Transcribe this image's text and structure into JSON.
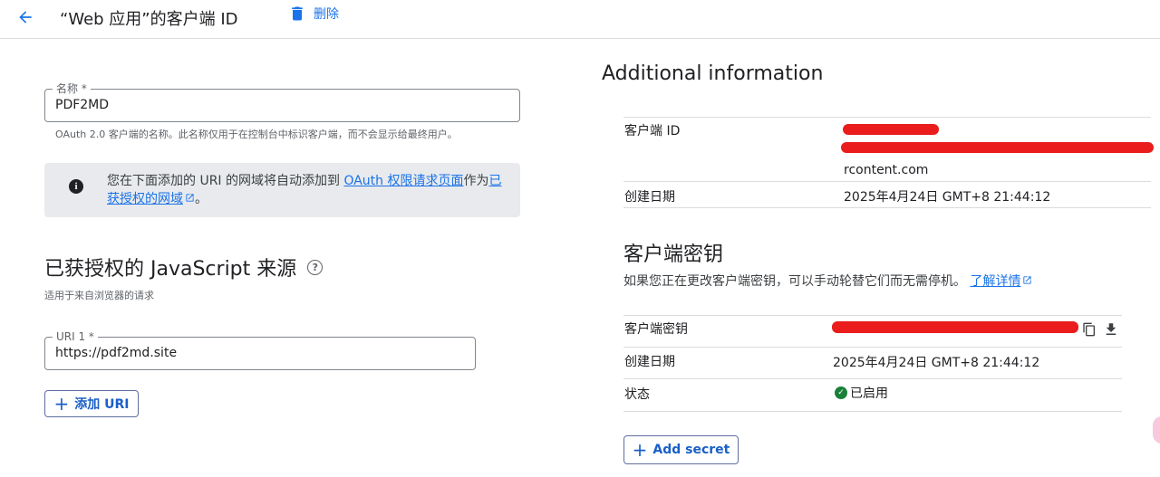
{
  "header": {
    "title": "“Web 应用”的客户端 ID",
    "delete_label": "删除"
  },
  "form": {
    "name_label": "名称 *",
    "name_value": "PDF2MD",
    "name_hint": "OAuth 2.0 客户端的名称。此名称仅用于在控制台中标识客户端，而不会显示给最终用户。",
    "info": {
      "text_before": "您在下面添加的 URI 的网域将自动添加到 ",
      "link1": "OAuth 权限请求页面",
      "text_middle": "作为",
      "link2": "已获授权的网域",
      "text_after": "。"
    },
    "js_origins": {
      "title": "已获授权的 JavaScript 来源",
      "subtitle": "适用于来自浏览器的请求",
      "uri_label": "URI 1 *",
      "uri_value": "https://pdf2md.site",
      "add_uri_label": "添加 URI"
    }
  },
  "additional": {
    "title": "Additional information",
    "client_id_label": "客户端 ID",
    "client_id_visible_tail": "rcontent.com",
    "created_label": "创建日期",
    "created_value": "2025年4月24日 GMT+8 21:44:12"
  },
  "secrets": {
    "title": "客户端密钥",
    "description": "如果您正在更改客户端密钥，可以手动轮替它们而无需停机。",
    "learn_more": "了解详情",
    "secret_label": "客户端密钥",
    "created_label": "创建日期",
    "created_value": "2025年4月24日 GMT+8 21:44:12",
    "status_label": "状态",
    "status_value": "已启用",
    "add_secret_label": "Add secret",
    "icons": [
      "copy-icon",
      "download-icon",
      "check-circle-icon",
      "external-link-icon"
    ]
  },
  "colors": {
    "accent": "#1a73e8",
    "redaction": "#ea1c1c",
    "status_green": "#188038",
    "info_bg": "#e8eaed"
  }
}
